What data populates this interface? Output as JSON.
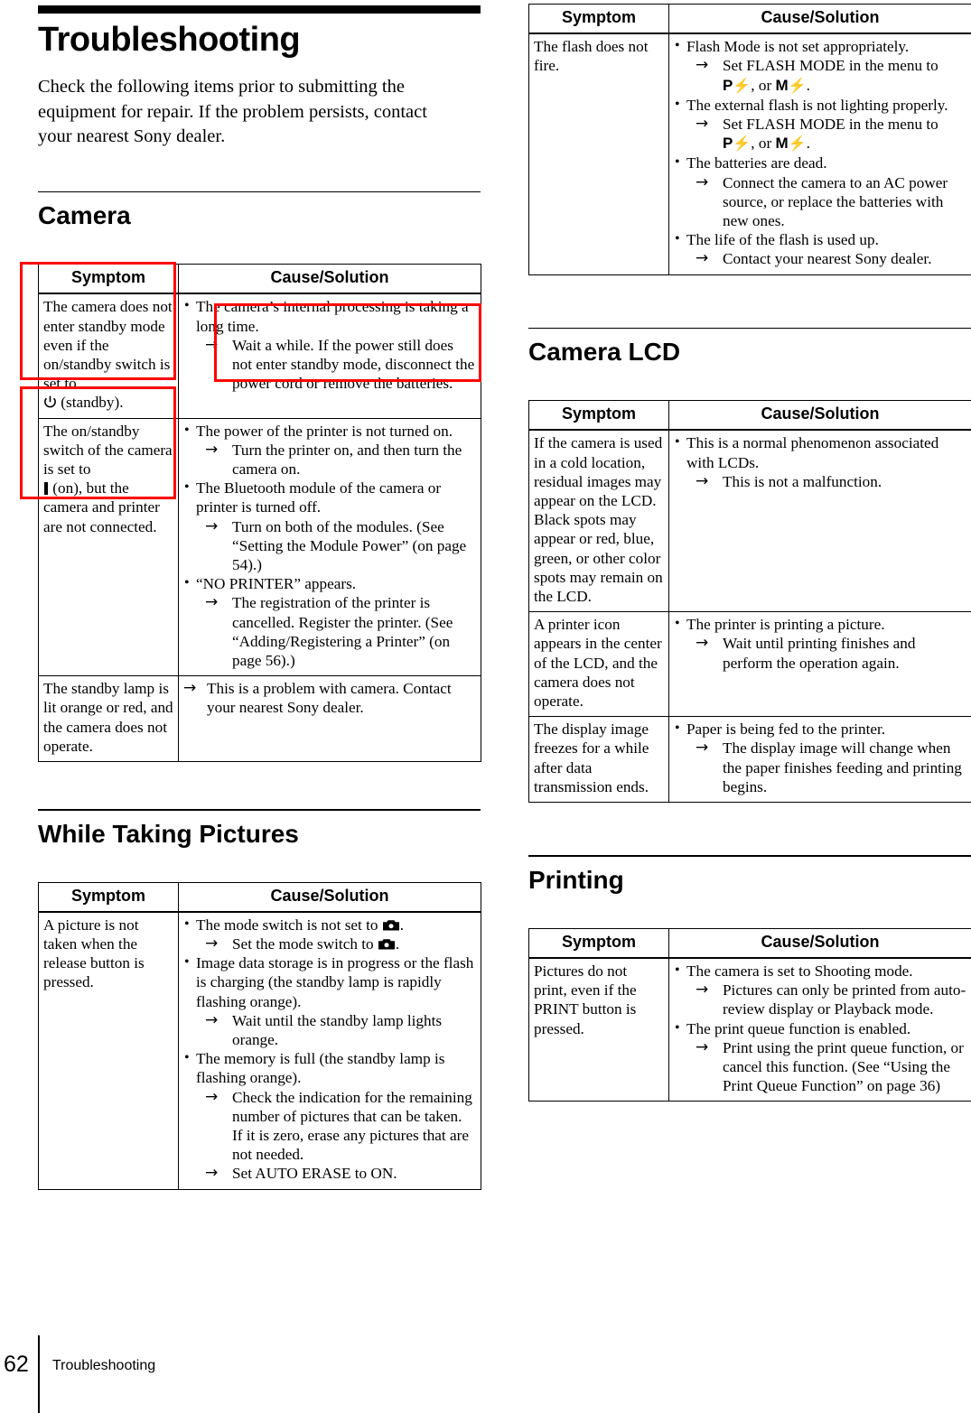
{
  "chapter": {
    "title": "Troubleshooting",
    "intro": "Check the following items prior to submitting the equipment for repair. If the problem persists, contact your nearest Sony dealer."
  },
  "table_headers": {
    "symptom": "Symptom",
    "solution": "Cause/Solution"
  },
  "sections": {
    "camera": {
      "title": "Camera"
    },
    "while_taking_pictures": {
      "title": "While Taking Pictures"
    },
    "camera_lcd": {
      "title": "Camera LCD"
    },
    "printing": {
      "title": "Printing"
    }
  },
  "camera_table": {
    "rows": [
      {
        "symptom_pre": "The camera does not enter standby mode even if the on/standby switch is set to",
        "symptom_post": "(standby).",
        "symptom_icon": "standby-power-icon",
        "items": [
          {
            "bullet": "The camera’s internal processing is taking a long time.",
            "arrow": "Wait a while. If the power still does not enter standby mode, disconnect the power cord or remove the batteries."
          }
        ]
      },
      {
        "symptom_a": "The on/standby switch of the camera is set to",
        "symptom_b": "(on), but the camera and printer are not connected.",
        "symptom_icon": "on-bar-icon",
        "items": [
          {
            "bullet": "The power of the printer is not turned on.",
            "arrow": "Turn the printer on, and then turn the camera on."
          },
          {
            "bullet": "The Bluetooth module of the camera or printer is turned off.",
            "arrow": "Turn on both of the modules. (See “Setting the Module Power” (on page 54).)"
          },
          {
            "bullet": "“NO PRINTER” appears.",
            "arrow": "The registration of the printer is cancelled. Register the printer. (See “Adding/Registering a Printer” (on page 56).)"
          }
        ]
      },
      {
        "symptom_plain": "The standby lamp is lit orange or red, and the camera does not operate.",
        "arrow_only": "This is a problem with camera. Contact your nearest Sony dealer."
      }
    ]
  },
  "while_taking_pictures_table": {
    "rows": [
      {
        "symptom_plain": "A picture is not taken when the release button is pressed.",
        "items": [
          {
            "bullet_pre": "The mode switch is not set to",
            "bullet_icon": "camera-mode-icon",
            "bullet_post": ".",
            "arrow_pre": "Set the mode switch to",
            "arrow_icon": "camera-mode-icon",
            "arrow_post": "."
          },
          {
            "bullet": "Image data storage is in progress or the flash is charging (the standby lamp is rapidly flashing orange).",
            "arrow": "Wait until the standby lamp lights orange."
          },
          {
            "bullet": "The memory is full (the standby lamp is flashing orange).",
            "arrow": "Check the indication for the remaining number of pictures that can be taken. If it is zero, erase any pictures that are not needed.",
            "arrow2": "Set AUTO ERASE to ON."
          }
        ]
      }
    ]
  },
  "flash_table": {
    "rows": [
      {
        "symptom_plain": "The flash does not fire.",
        "items": [
          {
            "bullet": "Flash Mode is not set appropriately.",
            "arrow_pre": "Set FLASH MODE in the menu to",
            "arrow_icon_a": "flash-mode-p-icon",
            "arrow_icon_a_label": "P",
            "arrow_mid": ", or ",
            "arrow_icon_b": "flash-mode-m-icon",
            "arrow_icon_b_label": "M",
            "arrow_post": "."
          },
          {
            "bullet": "The external flash is not lighting properly.",
            "arrow_pre": "Set FLASH MODE in the menu to",
            "arrow_icon_a": "flash-mode-p-icon",
            "arrow_icon_a_label": "P",
            "arrow_mid": ", or ",
            "arrow_icon_b": "flash-mode-m-icon",
            "arrow_icon_b_label": "M",
            "arrow_post": "."
          },
          {
            "bullet": "The batteries are dead.",
            "arrow": "Connect the camera to an AC power source, or replace the batteries with new ones."
          },
          {
            "bullet": "The life of the flash is used up.",
            "arrow": "Contact your nearest Sony dealer."
          }
        ]
      }
    ]
  },
  "camera_lcd_table": {
    "rows": [
      {
        "symptom_plain": "If the camera is used in a cold location, residual images may appear on the LCD.\nBlack spots may appear or red, blue, green, or other color spots may remain on the LCD.",
        "items": [
          {
            "bullet": "This is a normal phenomenon associated with LCDs.",
            "arrow": "This is not a malfunction."
          }
        ]
      },
      {
        "symptom_plain": "A printer icon appears in the center of the LCD, and the camera does not operate.",
        "items": [
          {
            "bullet": "The printer is printing a picture.",
            "arrow": "Wait until printing finishes and perform the operation again."
          }
        ]
      },
      {
        "symptom_plain": "The display image freezes for a while after data transmission ends.",
        "items": [
          {
            "bullet": "Paper is being fed to the printer.",
            "arrow": "The display image will change when the paper finishes feeding and printing begins."
          }
        ]
      }
    ]
  },
  "printing_table": {
    "rows": [
      {
        "symptom_plain": "Pictures do not print, even if the PRINT button is pressed.",
        "items": [
          {
            "bullet": "The camera is set to Shooting mode.",
            "arrow": "Pictures can only be printed from auto-review display or Playback mode."
          },
          {
            "bullet": "The print queue function is enabled.",
            "arrow": "Print using the print queue function, or cancel this function. (See “Using the Print Queue Function” on page 36)"
          }
        ]
      }
    ]
  },
  "highlights": {
    "color": "#ff0000",
    "boxes": [
      {
        "name": "highlight-symptom-standby"
      },
      {
        "name": "highlight-solution-wait-a-while"
      },
      {
        "name": "highlight-symptom-on-switch"
      }
    ]
  },
  "footer": {
    "page_number": "62",
    "label": "Troubleshooting"
  }
}
